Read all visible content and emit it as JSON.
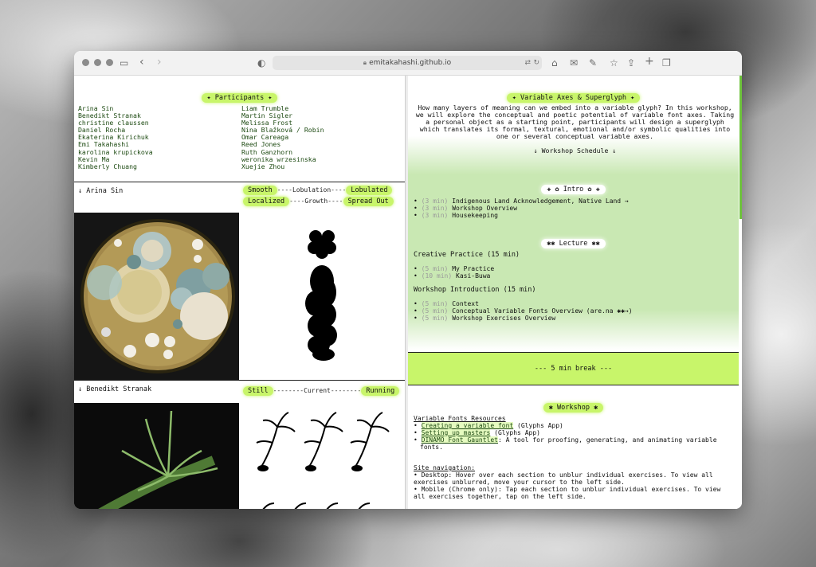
{
  "browser": {
    "url": "emitakahashi.github.io"
  },
  "participants": {
    "title": "✦ Participants ✦",
    "col1": [
      "Arina Sin",
      "Benedikt Stranak",
      "christine claussen",
      "Daniel Rocha",
      "Ekaterina Kirichuk",
      "Emi Takahashi",
      "karolina krupickova",
      "Kevin Ma",
      "Kimberly Chuang"
    ],
    "col2": [
      "Liam Trumble",
      "Martin Sigler",
      "Melissa Frost",
      "Nina Blažková / Robin",
      "Omar Careaga",
      "Reed Jones",
      "Ruth Ganzhorn",
      "weronika wrzesinska",
      "Xuejie Zhou"
    ]
  },
  "arina": {
    "name": "↓ Arina Sin",
    "axis1_left": "Smooth",
    "axis1_mid": "----Lobulation----",
    "axis1_right": "Lobulated",
    "axis2_left": "Localized",
    "axis2_mid": "----Growth----",
    "axis2_right": "Spread Out"
  },
  "benedikt": {
    "name": "↓ Benedikt Stranak",
    "axis_left": "Still",
    "axis_mid": "--------Current--------",
    "axis_right": "Running"
  },
  "main": {
    "title": "✦ Variable Axes & Superglyph ✦",
    "intro_para": "How many layers of meaning can we embed into a variable glyph? In this workshop, we will explore the conceptual and poetic potential of variable font axes. Taking a personal object as a starting point, participants will design a superglyph which translates its formal, textural, emotional and/or symbolic qualities into one or several conceptual variable axes.",
    "schedule_link": "↓ Workshop Schedule ↓",
    "intro_title": "✚ ✿ Intro ✿ ✚",
    "intro_items": [
      {
        "min": "(3 min)",
        "text": "Indigenous Land Acknowledgement, Native Land →"
      },
      {
        "min": "(3 min)",
        "text": "Workshop Overview"
      },
      {
        "min": "(3 min)",
        "text": "Housekeeping"
      }
    ],
    "lecture_title": "✱✱ Lecture ✱✱",
    "creative_heading": "Creative Practice (15 min)",
    "creative_items": [
      {
        "min": "(5 min)",
        "text": "My Practice"
      },
      {
        "min": "(10 min)",
        "text": "Kasi-Buwa"
      }
    ],
    "intro_heading": "Workshop Introduction (15 min)",
    "intro2_items": [
      {
        "min": "(5 min)",
        "text": "Context"
      },
      {
        "min": "(5 min)",
        "text": "Conceptual Variable Fonts Overview (are.na ✱✱→)"
      },
      {
        "min": "(5 min)",
        "text": "Workshop Exercises Overview"
      }
    ],
    "break_text": "--- 5 min break ---",
    "workshop_title": "✱ Workshop ✱",
    "resources_heading": "Variable Fonts Resources",
    "resources": [
      {
        "link": "Creating a variable font",
        "rest": " (Glyphs App)"
      },
      {
        "link": "Setting up masters",
        "rest": " (Glyphs App)"
      },
      {
        "link": "DINAMO Font Gauntlet",
        "rest": ": A tool for proofing, generating, and animating variable fonts."
      }
    ],
    "nav_heading": "Site navigation:",
    "nav_desktop": "• Desktop: Hover over each section to unblur individual exercises. To view all exercises unblurred, move your cursor to the left side.",
    "nav_mobile": "• Mobile (Chrome only): Tap each section to unblur individual exercises. To view all exercises together, tap on the left side."
  }
}
